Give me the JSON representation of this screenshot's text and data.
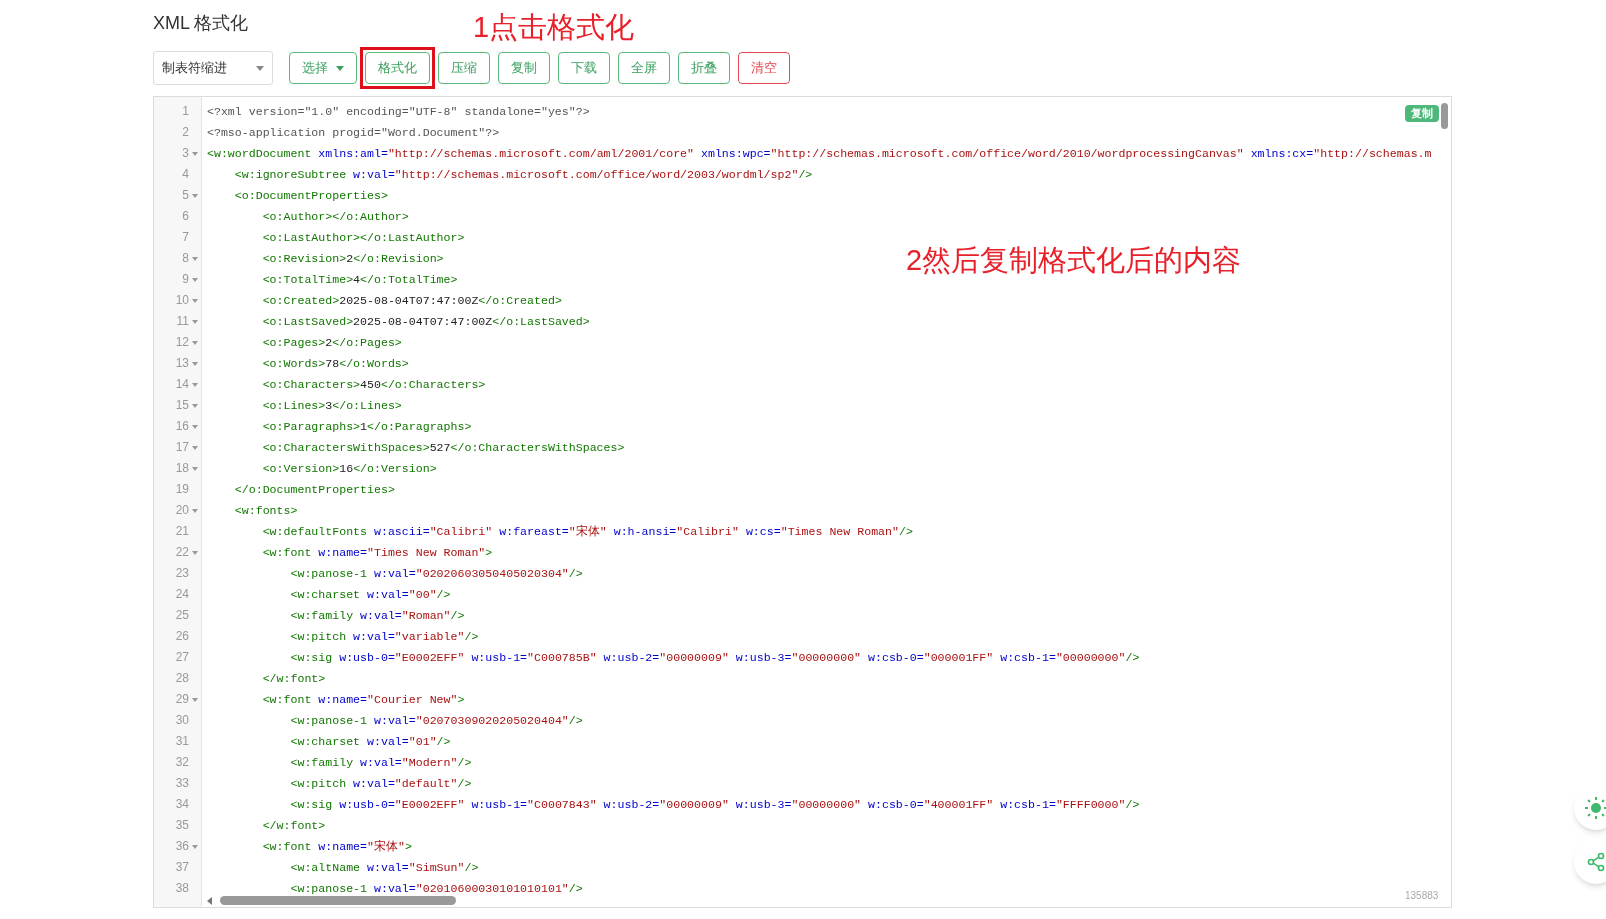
{
  "page_title": "XML 格式化",
  "indent_select": {
    "value": "制表符缩进"
  },
  "buttons": [
    {
      "label": "选择",
      "kind": "dropdown",
      "highlighted": false
    },
    {
      "label": "格式化",
      "kind": "normal",
      "highlighted": true
    },
    {
      "label": "压缩",
      "kind": "normal",
      "highlighted": false
    },
    {
      "label": "复制",
      "kind": "normal",
      "highlighted": false
    },
    {
      "label": "下载",
      "kind": "normal",
      "highlighted": false
    },
    {
      "label": "全屏",
      "kind": "normal",
      "highlighted": false
    },
    {
      "label": "折叠",
      "kind": "normal",
      "highlighted": false
    },
    {
      "label": "清空",
      "kind": "danger",
      "highlighted": false
    }
  ],
  "annotations": [
    "1点击格式化",
    "2然后复制格式化后的内容"
  ],
  "editor": {
    "copy_badge": "复制",
    "char_count": "135883",
    "lines": [
      {
        "n": "1",
        "fold": false,
        "tokens": [
          {
            "kind": "pi",
            "text": "<?xml version=\"1.0\" encoding=\"UTF-8\" standalone=\"yes\"?>"
          }
        ]
      },
      {
        "n": "2",
        "fold": false,
        "tokens": [
          {
            "kind": "pi",
            "text": "<?mso-application progid=\"Word.Document\"?>"
          }
        ]
      },
      {
        "n": "3",
        "fold": true,
        "tokens": [
          {
            "kind": "tag",
            "text": "<w:wordDocument"
          },
          {
            "kind": "attr",
            "text": " xmlns:aml="
          },
          {
            "kind": "str",
            "text": "\"http://schemas.microsoft.com/aml/2001/core\""
          },
          {
            "kind": "attr",
            "text": " xmlns:wpc="
          },
          {
            "kind": "str",
            "text": "\"http://schemas.microsoft.com/office/word/2010/wordprocessingCanvas\""
          },
          {
            "kind": "attr",
            "text": " xmlns:cx="
          },
          {
            "kind": "str",
            "text": "\"http://schemas.m"
          }
        ]
      },
      {
        "n": "4",
        "fold": false,
        "tokens": [
          {
            "kind": "tag",
            "text": "    <w:ignoreSubtree"
          },
          {
            "kind": "attr",
            "text": " w:val="
          },
          {
            "kind": "str",
            "text": "\"http://schemas.microsoft.com/office/word/2003/wordml/sp2\""
          },
          {
            "kind": "tag",
            "text": "/>"
          }
        ]
      },
      {
        "n": "5",
        "fold": true,
        "tokens": [
          {
            "kind": "tag",
            "text": "    <o:DocumentProperties>"
          }
        ]
      },
      {
        "n": "6",
        "fold": false,
        "tokens": [
          {
            "kind": "tag",
            "text": "        <o:Author></o:Author>"
          }
        ]
      },
      {
        "n": "7",
        "fold": false,
        "tokens": [
          {
            "kind": "tag",
            "text": "        <o:LastAuthor></o:LastAuthor>"
          }
        ]
      },
      {
        "n": "8",
        "fold": true,
        "tokens": [
          {
            "kind": "tag",
            "text": "        <o:Revision>"
          },
          {
            "kind": "text",
            "text": "2"
          },
          {
            "kind": "tag",
            "text": "</o:Revision>"
          }
        ]
      },
      {
        "n": "9",
        "fold": true,
        "tokens": [
          {
            "kind": "tag",
            "text": "        <o:TotalTime>"
          },
          {
            "kind": "text",
            "text": "4"
          },
          {
            "kind": "tag",
            "text": "</o:TotalTime>"
          }
        ]
      },
      {
        "n": "10",
        "fold": true,
        "tokens": [
          {
            "kind": "tag",
            "text": "        <o:Created>"
          },
          {
            "kind": "text",
            "text": "2025-08-04T07:47:00Z"
          },
          {
            "kind": "tag",
            "text": "</o:Created>"
          }
        ]
      },
      {
        "n": "11",
        "fold": true,
        "tokens": [
          {
            "kind": "tag",
            "text": "        <o:LastSaved>"
          },
          {
            "kind": "text",
            "text": "2025-08-04T07:47:00Z"
          },
          {
            "kind": "tag",
            "text": "</o:LastSaved>"
          }
        ]
      },
      {
        "n": "12",
        "fold": true,
        "tokens": [
          {
            "kind": "tag",
            "text": "        <o:Pages>"
          },
          {
            "kind": "text",
            "text": "2"
          },
          {
            "kind": "tag",
            "text": "</o:Pages>"
          }
        ]
      },
      {
        "n": "13",
        "fold": true,
        "tokens": [
          {
            "kind": "tag",
            "text": "        <o:Words>"
          },
          {
            "kind": "text",
            "text": "78"
          },
          {
            "kind": "tag",
            "text": "</o:Words>"
          }
        ]
      },
      {
        "n": "14",
        "fold": true,
        "tokens": [
          {
            "kind": "tag",
            "text": "        <o:Characters>"
          },
          {
            "kind": "text",
            "text": "450"
          },
          {
            "kind": "tag",
            "text": "</o:Characters>"
          }
        ]
      },
      {
        "n": "15",
        "fold": true,
        "tokens": [
          {
            "kind": "tag",
            "text": "        <o:Lines>"
          },
          {
            "kind": "text",
            "text": "3"
          },
          {
            "kind": "tag",
            "text": "</o:Lines>"
          }
        ]
      },
      {
        "n": "16",
        "fold": true,
        "tokens": [
          {
            "kind": "tag",
            "text": "        <o:Paragraphs>"
          },
          {
            "kind": "text",
            "text": "1"
          },
          {
            "kind": "tag",
            "text": "</o:Paragraphs>"
          }
        ]
      },
      {
        "n": "17",
        "fold": true,
        "tokens": [
          {
            "kind": "tag",
            "text": "        <o:CharactersWithSpaces>"
          },
          {
            "kind": "text",
            "text": "527"
          },
          {
            "kind": "tag",
            "text": "</o:CharactersWithSpaces>"
          }
        ]
      },
      {
        "n": "18",
        "fold": true,
        "tokens": [
          {
            "kind": "tag",
            "text": "        <o:Version>"
          },
          {
            "kind": "text",
            "text": "16"
          },
          {
            "kind": "tag",
            "text": "</o:Version>"
          }
        ]
      },
      {
        "n": "19",
        "fold": false,
        "tokens": [
          {
            "kind": "tag",
            "text": "    </o:DocumentProperties>"
          }
        ]
      },
      {
        "n": "20",
        "fold": true,
        "tokens": [
          {
            "kind": "tag",
            "text": "    <w:fonts>"
          }
        ]
      },
      {
        "n": "21",
        "fold": false,
        "tokens": [
          {
            "kind": "tag",
            "text": "        <w:defaultFonts"
          },
          {
            "kind": "attr",
            "text": " w:ascii="
          },
          {
            "kind": "str",
            "text": "\"Calibri\""
          },
          {
            "kind": "attr",
            "text": " w:fareast="
          },
          {
            "kind": "str",
            "text": "\"宋体\""
          },
          {
            "kind": "attr",
            "text": " w:h-ansi="
          },
          {
            "kind": "str",
            "text": "\"Calibri\""
          },
          {
            "kind": "attr",
            "text": " w:cs="
          },
          {
            "kind": "str",
            "text": "\"Times New Roman\""
          },
          {
            "kind": "tag",
            "text": "/>"
          }
        ]
      },
      {
        "n": "22",
        "fold": true,
        "tokens": [
          {
            "kind": "tag",
            "text": "        <w:font"
          },
          {
            "kind": "attr",
            "text": " w:name="
          },
          {
            "kind": "str",
            "text": "\"Times New Roman\""
          },
          {
            "kind": "tag",
            "text": ">"
          }
        ]
      },
      {
        "n": "23",
        "fold": false,
        "tokens": [
          {
            "kind": "tag",
            "text": "            <w:panose-1"
          },
          {
            "kind": "attr",
            "text": " w:val="
          },
          {
            "kind": "str",
            "text": "\"02020603050405020304\""
          },
          {
            "kind": "tag",
            "text": "/>"
          }
        ]
      },
      {
        "n": "24",
        "fold": false,
        "tokens": [
          {
            "kind": "tag",
            "text": "            <w:charset"
          },
          {
            "kind": "attr",
            "text": " w:val="
          },
          {
            "kind": "str",
            "text": "\"00\""
          },
          {
            "kind": "tag",
            "text": "/>"
          }
        ]
      },
      {
        "n": "25",
        "fold": false,
        "tokens": [
          {
            "kind": "tag",
            "text": "            <w:family"
          },
          {
            "kind": "attr",
            "text": " w:val="
          },
          {
            "kind": "str",
            "text": "\"Roman\""
          },
          {
            "kind": "tag",
            "text": "/>"
          }
        ]
      },
      {
        "n": "26",
        "fold": false,
        "tokens": [
          {
            "kind": "tag",
            "text": "            <w:pitch"
          },
          {
            "kind": "attr",
            "text": " w:val="
          },
          {
            "kind": "str",
            "text": "\"variable\""
          },
          {
            "kind": "tag",
            "text": "/>"
          }
        ]
      },
      {
        "n": "27",
        "fold": false,
        "tokens": [
          {
            "kind": "tag",
            "text": "            <w:sig"
          },
          {
            "kind": "attr",
            "text": " w:usb-0="
          },
          {
            "kind": "str",
            "text": "\"E0002EFF\""
          },
          {
            "kind": "attr",
            "text": " w:usb-1="
          },
          {
            "kind": "str",
            "text": "\"C000785B\""
          },
          {
            "kind": "attr",
            "text": " w:usb-2="
          },
          {
            "kind": "str",
            "text": "\"00000009\""
          },
          {
            "kind": "attr",
            "text": " w:usb-3="
          },
          {
            "kind": "str",
            "text": "\"00000000\""
          },
          {
            "kind": "attr",
            "text": " w:csb-0="
          },
          {
            "kind": "str",
            "text": "\"000001FF\""
          },
          {
            "kind": "attr",
            "text": " w:csb-1="
          },
          {
            "kind": "str",
            "text": "\"00000000\""
          },
          {
            "kind": "tag",
            "text": "/>"
          }
        ]
      },
      {
        "n": "28",
        "fold": false,
        "tokens": [
          {
            "kind": "tag",
            "text": "        </w:font>"
          }
        ]
      },
      {
        "n": "29",
        "fold": true,
        "tokens": [
          {
            "kind": "tag",
            "text": "        <w:font"
          },
          {
            "kind": "attr",
            "text": " w:name="
          },
          {
            "kind": "str",
            "text": "\"Courier New\""
          },
          {
            "kind": "tag",
            "text": ">"
          }
        ]
      },
      {
        "n": "30",
        "fold": false,
        "tokens": [
          {
            "kind": "tag",
            "text": "            <w:panose-1"
          },
          {
            "kind": "attr",
            "text": " w:val="
          },
          {
            "kind": "str",
            "text": "\"02070309020205020404\""
          },
          {
            "kind": "tag",
            "text": "/>"
          }
        ]
      },
      {
        "n": "31",
        "fold": false,
        "tokens": [
          {
            "kind": "tag",
            "text": "            <w:charset"
          },
          {
            "kind": "attr",
            "text": " w:val="
          },
          {
            "kind": "str",
            "text": "\"01\""
          },
          {
            "kind": "tag",
            "text": "/>"
          }
        ]
      },
      {
        "n": "32",
        "fold": false,
        "tokens": [
          {
            "kind": "tag",
            "text": "            <w:family"
          },
          {
            "kind": "attr",
            "text": " w:val="
          },
          {
            "kind": "str",
            "text": "\"Modern\""
          },
          {
            "kind": "tag",
            "text": "/>"
          }
        ]
      },
      {
        "n": "33",
        "fold": false,
        "tokens": [
          {
            "kind": "tag",
            "text": "            <w:pitch"
          },
          {
            "kind": "attr",
            "text": " w:val="
          },
          {
            "kind": "str",
            "text": "\"default\""
          },
          {
            "kind": "tag",
            "text": "/>"
          }
        ]
      },
      {
        "n": "34",
        "fold": false,
        "tokens": [
          {
            "kind": "tag",
            "text": "            <w:sig"
          },
          {
            "kind": "attr",
            "text": " w:usb-0="
          },
          {
            "kind": "str",
            "text": "\"E0002EFF\""
          },
          {
            "kind": "attr",
            "text": " w:usb-1="
          },
          {
            "kind": "str",
            "text": "\"C0007843\""
          },
          {
            "kind": "attr",
            "text": " w:usb-2="
          },
          {
            "kind": "str",
            "text": "\"00000009\""
          },
          {
            "kind": "attr",
            "text": " w:usb-3="
          },
          {
            "kind": "str",
            "text": "\"00000000\""
          },
          {
            "kind": "attr",
            "text": " w:csb-0="
          },
          {
            "kind": "str",
            "text": "\"400001FF\""
          },
          {
            "kind": "attr",
            "text": " w:csb-1="
          },
          {
            "kind": "str",
            "text": "\"FFFF0000\""
          },
          {
            "kind": "tag",
            "text": "/>"
          }
        ]
      },
      {
        "n": "35",
        "fold": false,
        "tokens": [
          {
            "kind": "tag",
            "text": "        </w:font>"
          }
        ]
      },
      {
        "n": "36",
        "fold": true,
        "tokens": [
          {
            "kind": "tag",
            "text": "        <w:font"
          },
          {
            "kind": "attr",
            "text": " w:name="
          },
          {
            "kind": "str",
            "text": "\"宋体\""
          },
          {
            "kind": "tag",
            "text": ">"
          }
        ]
      },
      {
        "n": "37",
        "fold": false,
        "tokens": [
          {
            "kind": "tag",
            "text": "            <w:altName"
          },
          {
            "kind": "attr",
            "text": " w:val="
          },
          {
            "kind": "str",
            "text": "\"SimSun\""
          },
          {
            "kind": "tag",
            "text": "/>"
          }
        ]
      },
      {
        "n": "38",
        "fold": false,
        "tokens": [
          {
            "kind": "tag",
            "text": "            <w:panose-1"
          },
          {
            "kind": "attr",
            "text": " w:val="
          },
          {
            "kind": "str",
            "text": "\"02010600030101010101\""
          },
          {
            "kind": "tag",
            "text": "/>"
          }
        ]
      }
    ]
  }
}
